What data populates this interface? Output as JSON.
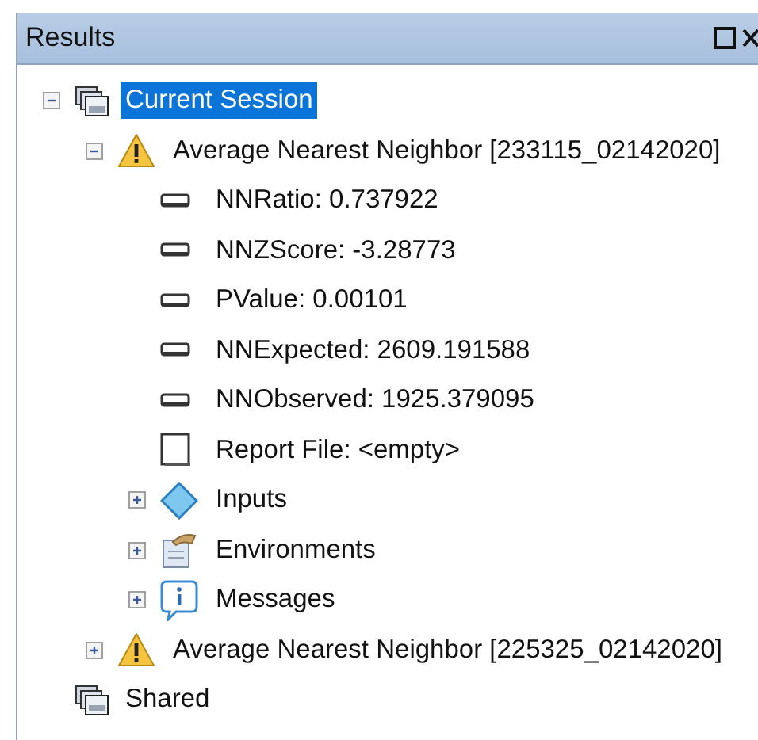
{
  "panel": {
    "title": "Results"
  },
  "tree": [
    {
      "label": "Current Session",
      "kind": "session",
      "expanded": true,
      "selected": true,
      "children": [
        {
          "label": "Average Nearest Neighbor [233115_02142020]",
          "kind": "warning",
          "expanded": true,
          "selected": false,
          "children": [
            {
              "label": "NNRatio: 0.737922",
              "kind": "value",
              "selected": false
            },
            {
              "label": "NNZScore: -3.28773",
              "kind": "value",
              "selected": false
            },
            {
              "label": "PValue: 0.00101",
              "kind": "value",
              "selected": false
            },
            {
              "label": "NNExpected: 2609.191588",
              "kind": "value",
              "selected": false
            },
            {
              "label": "NNObserved: 1925.379095",
              "kind": "value",
              "selected": false
            },
            {
              "label": "Report File: <empty>",
              "kind": "file",
              "selected": false
            },
            {
              "label": "Inputs",
              "kind": "inputs",
              "expanded": false,
              "selected": false
            },
            {
              "label": "Environments",
              "kind": "environments",
              "expanded": false,
              "selected": false
            },
            {
              "label": "Messages",
              "kind": "messages",
              "expanded": false,
              "selected": false
            }
          ]
        },
        {
          "label": "Average Nearest Neighbor [225325_02142020]",
          "kind": "warning",
          "expanded": false,
          "selected": false
        }
      ]
    },
    {
      "label": "Shared",
      "kind": "session",
      "selected": false
    }
  ]
}
